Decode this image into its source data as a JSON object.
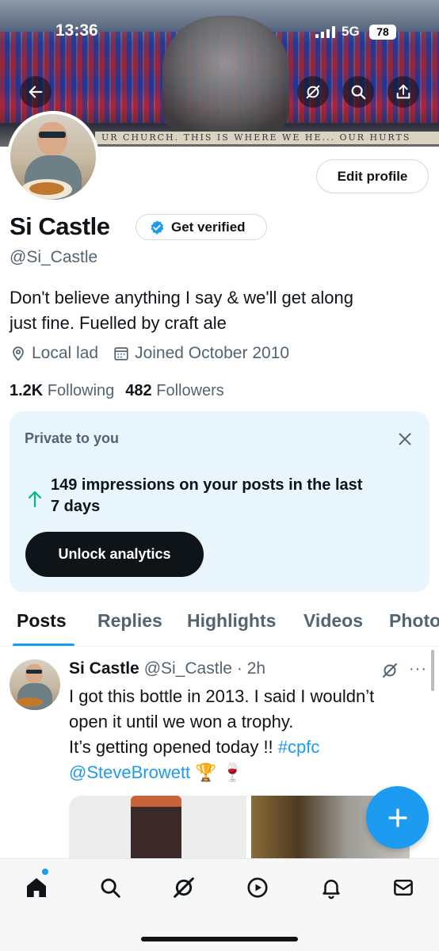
{
  "status_bar": {
    "time": "13:36",
    "network": "5G",
    "battery": "78"
  },
  "banner": {
    "text": "UR CHURCH. THIS IS WHERE WE HE... OUR HURTS"
  },
  "profile": {
    "name": "Si Castle",
    "get_verified_label": "Get verified",
    "handle": "@Si_Castle",
    "edit_profile_label": "Edit profile",
    "bio_line1": "Don't believe anything I say & we'll get along",
    "bio_line2": "just fine. Fuelled by craft ale",
    "location": "Local lad",
    "joined": "Joined October 2010",
    "following_count": "1.2K",
    "following_label": "Following",
    "followers_count": "482",
    "followers_label": "Followers"
  },
  "analytics_card": {
    "label": "Private to you",
    "impressions_line1": "149 impressions on your posts in the last",
    "impressions_line2": "7 days",
    "unlock_label": "Unlock analytics"
  },
  "tabs": [
    {
      "label": "Posts"
    },
    {
      "label": "Replies"
    },
    {
      "label": "Highlights"
    },
    {
      "label": "Videos"
    },
    {
      "label": "Photos"
    }
  ],
  "post": {
    "name": "Si Castle",
    "handle": "@Si_Castle",
    "time": "· 2h",
    "more": "···",
    "line1": "I got this bottle in 2013. I said I wouldn’t",
    "line2": "open it until we won a trophy.",
    "line3_text": "It’s getting opened today !! ",
    "hashtag": "#cpfc",
    "mention": "@SteveBrowett",
    "emojis": " 🏆 🍷"
  },
  "colors": {
    "accent": "#1d9bf0",
    "text_primary": "#0f1419",
    "text_secondary": "#536471",
    "card_bg": "#e8f5fd",
    "verified_badge": "#1d9bf0",
    "impression_arrow": "#00ba7c"
  },
  "nav": [
    "home-icon",
    "search-icon",
    "grok-icon",
    "play-icon",
    "bell-icon",
    "mail-icon"
  ]
}
